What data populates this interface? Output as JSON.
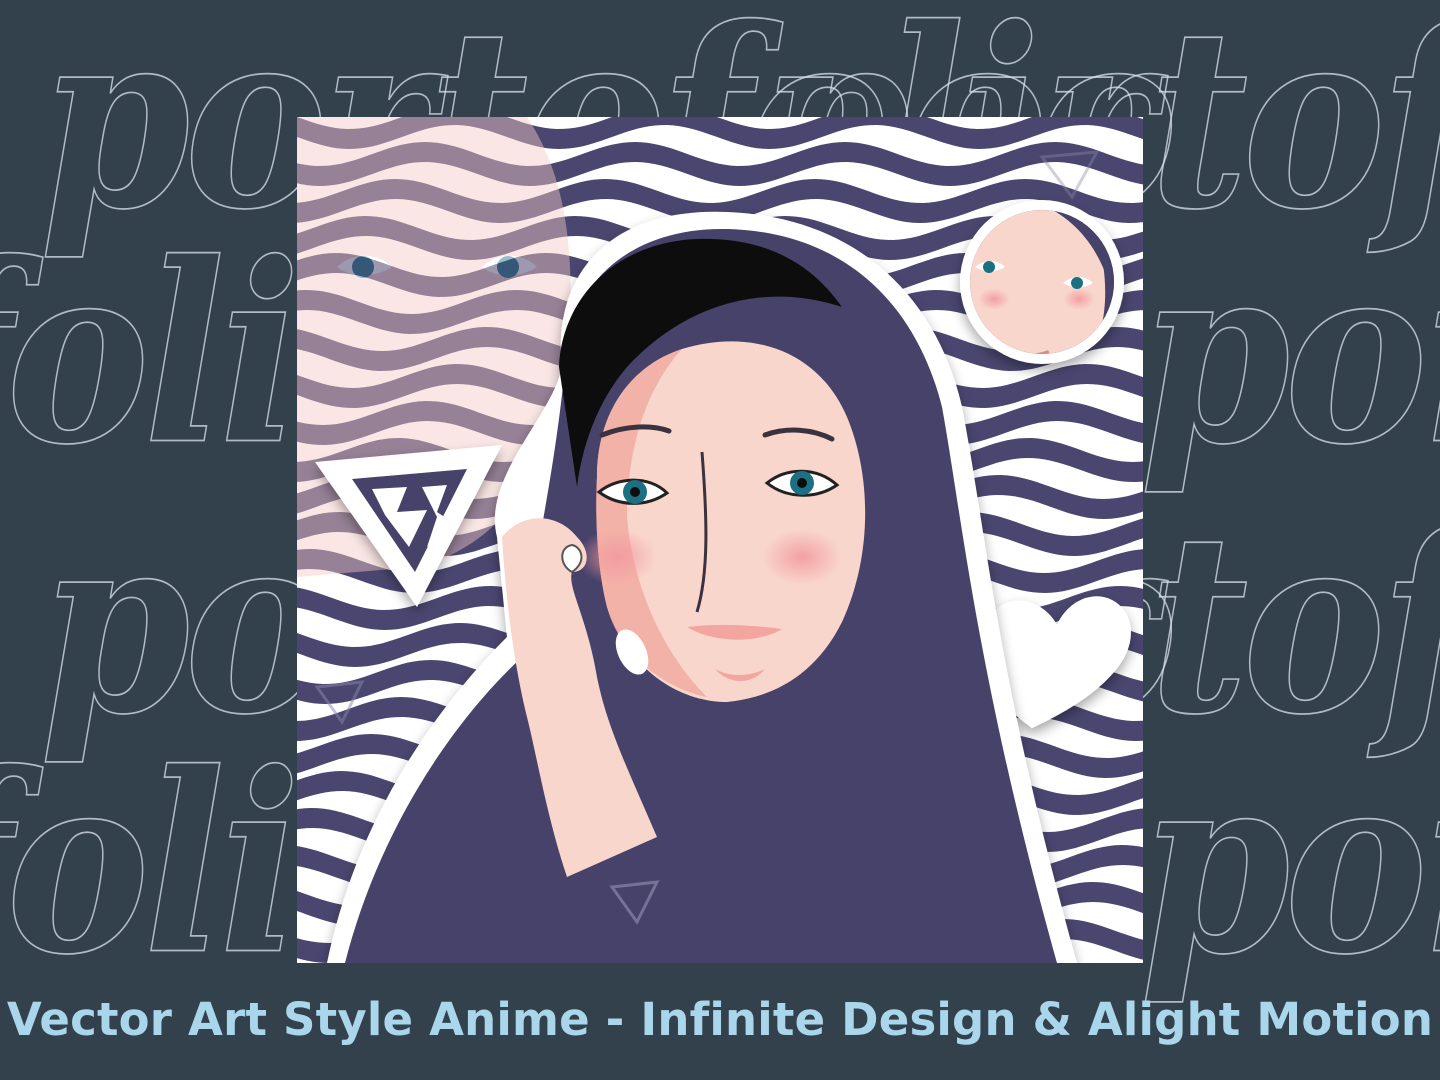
{
  "background": {
    "color": "#33414d",
    "watermark_word": "portofolio",
    "watermark_color": "#dce4ec"
  },
  "artwork": {
    "wave_color": "#4a4670",
    "hijab_color": "#47426a",
    "skin_color": "#f8d6cc",
    "blush_color": "#f39a9e",
    "eye_color": "#1f6f82",
    "sticker_outline": "#ffffff",
    "icons": [
      "logo-triangle-icon",
      "heart-icon",
      "avatar-badge"
    ]
  },
  "caption": {
    "text": "Vector Art Style Anime - Infinite Design & Alight Motion",
    "color": "#a9d6ea"
  }
}
